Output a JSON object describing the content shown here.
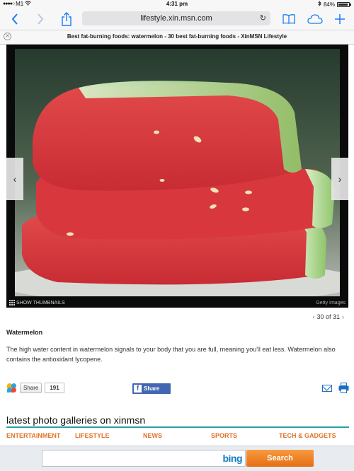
{
  "status_bar": {
    "carrier": "M1",
    "time": "4:31 pm",
    "battery": "84%"
  },
  "browser": {
    "url": "lifestyle.xin.msn.com",
    "tab_title": "Best fat-burning foods: watermelon - 30 best fat-burning foods - XinMSN Lifestyle"
  },
  "gallery": {
    "show_thumbnails": "SHOW THUMBNAILS",
    "credit": "Getty Images",
    "position": "30 of 31"
  },
  "caption": {
    "title": "Watermelon",
    "text": "The high water content in watermelon signals to your body that you are full, meaning you'll eat less. Watermelon also contains the antioxidant lycopene."
  },
  "social": {
    "share_label": "Share",
    "share_count": "191",
    "fb_share_label": "Share"
  },
  "galleries": {
    "title": "latest photo galleries on xinmsn",
    "categories": [
      "ENTERTAINMENT",
      "LIFESTYLE",
      "NEWS",
      "SPORTS",
      "TECH & GADGETS"
    ]
  },
  "bing": {
    "logo": "bing",
    "search_label": "Search",
    "placeholder": ""
  },
  "colors": {
    "accent_blue": "#1a7cf5",
    "section_rule": "#26a3a9",
    "category_orange": "#e2732a",
    "bing_orange": "#f08a2c",
    "facebook_blue": "#4267b2"
  }
}
